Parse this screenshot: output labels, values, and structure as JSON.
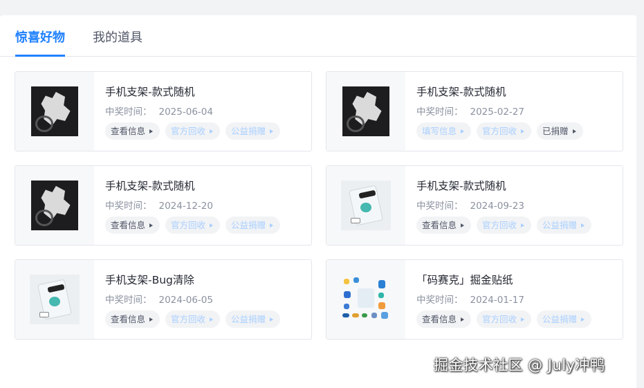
{
  "tabs": [
    {
      "label": "惊喜好物",
      "active": true
    },
    {
      "label": "我的道具",
      "active": false
    }
  ],
  "date_label": "中奖时间：",
  "prizes": [
    {
      "title": "手机支架-款式随机",
      "date": "2025-06-04",
      "image": "dark-phone-stand",
      "actions": [
        {
          "label": "查看信息",
          "style": "dark"
        },
        {
          "label": "官方回收",
          "style": "light"
        },
        {
          "label": "公益捐赠",
          "style": "light"
        }
      ]
    },
    {
      "title": "手机支架-款式随机",
      "date": "2025-02-27",
      "image": "dark-phone-stand",
      "actions": [
        {
          "label": "填写信息",
          "style": "light"
        },
        {
          "label": "官方回收",
          "style": "light"
        },
        {
          "label": "已捐赠",
          "style": "dark"
        }
      ]
    },
    {
      "title": "手机支架-款式随机",
      "date": "2024-12-20",
      "image": "dark-phone-stand",
      "actions": [
        {
          "label": "查看信息",
          "style": "dark"
        },
        {
          "label": "官方回收",
          "style": "light"
        },
        {
          "label": "公益捐赠",
          "style": "light"
        }
      ]
    },
    {
      "title": "手机支架-款式随机",
      "date": "2024-09-23",
      "image": "clear-phone-stand",
      "actions": [
        {
          "label": "查看信息",
          "style": "dark"
        },
        {
          "label": "官方回收",
          "style": "light"
        },
        {
          "label": "公益捐赠",
          "style": "light"
        }
      ]
    },
    {
      "title": "手机支架-Bug清除",
      "date": "2024-06-05",
      "image": "clear-phone-stand",
      "actions": [
        {
          "label": "查看信息",
          "style": "dark"
        },
        {
          "label": "官方回收",
          "style": "light"
        },
        {
          "label": "公益捐赠",
          "style": "light"
        }
      ]
    },
    {
      "title": "「码赛克」掘金贴纸",
      "date": "2024-01-17",
      "image": "sticker-sheet",
      "actions": [
        {
          "label": "查看信息",
          "style": "dark"
        },
        {
          "label": "官方回收",
          "style": "light"
        },
        {
          "label": "公益捐赠",
          "style": "light"
        }
      ]
    }
  ],
  "watermark": "掘金技术社区 @ July冲鸭",
  "colors": {
    "accent": "#1e80ff",
    "action_dark": "#515767",
    "action_light": "#a8cfff"
  }
}
